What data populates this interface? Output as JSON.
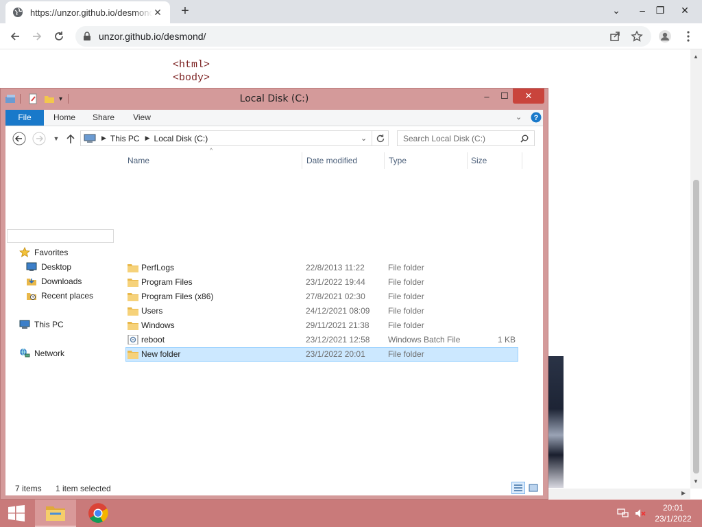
{
  "browser": {
    "tab_title": "https://unzor.github.io/desmond/",
    "url": "unzor.github.io/desmond/"
  },
  "page": {
    "code_lines": [
      "<html>",
      "<body>"
    ]
  },
  "explorer": {
    "title": "Local Disk (C:)",
    "ribbon_tabs": [
      "File",
      "Home",
      "Share",
      "View"
    ],
    "breadcrumb": [
      "This PC",
      "Local Disk (C:)"
    ],
    "search_placeholder": "Search Local Disk (C:)",
    "nav": {
      "favorites": "Favorites",
      "desktop": "Desktop",
      "downloads": "Downloads",
      "recent": "Recent places",
      "this_pc": "This PC",
      "network": "Network"
    },
    "columns": {
      "name": "Name",
      "date": "Date modified",
      "type": "Type",
      "size": "Size"
    },
    "files": [
      {
        "name": "PerfLogs",
        "date": "22/8/2013 11:22",
        "type": "File folder",
        "size": "",
        "icon": "folder-icon"
      },
      {
        "name": "Program Files",
        "date": "23/1/2022 19:44",
        "type": "File folder",
        "size": "",
        "icon": "folder-icon"
      },
      {
        "name": "Program Files (x86)",
        "date": "27/8/2021 02:30",
        "type": "File folder",
        "size": "",
        "icon": "folder-icon"
      },
      {
        "name": "Users",
        "date": "24/12/2021 08:09",
        "type": "File folder",
        "size": "",
        "icon": "folder-icon"
      },
      {
        "name": "Windows",
        "date": "29/11/2021 21:38",
        "type": "File folder",
        "size": "",
        "icon": "folder-icon"
      },
      {
        "name": "reboot",
        "date": "23/12/2021 12:58",
        "type": "Windows Batch File",
        "size": "1 KB",
        "icon": "batch-file-icon"
      },
      {
        "name": "New folder",
        "date": "23/1/2022 20:01",
        "type": "File folder",
        "size": "",
        "icon": "folder-icon",
        "selected": true
      }
    ],
    "status": {
      "count": "7 items",
      "selected": "1 item selected"
    }
  },
  "taskbar": {
    "time": "20:01",
    "date": "23/1/2022"
  },
  "colors": {
    "window_frame": "#d49a9a",
    "taskbar": "#c97a7a",
    "ribbon_file": "#1979ca",
    "selection": "#cce8ff"
  }
}
